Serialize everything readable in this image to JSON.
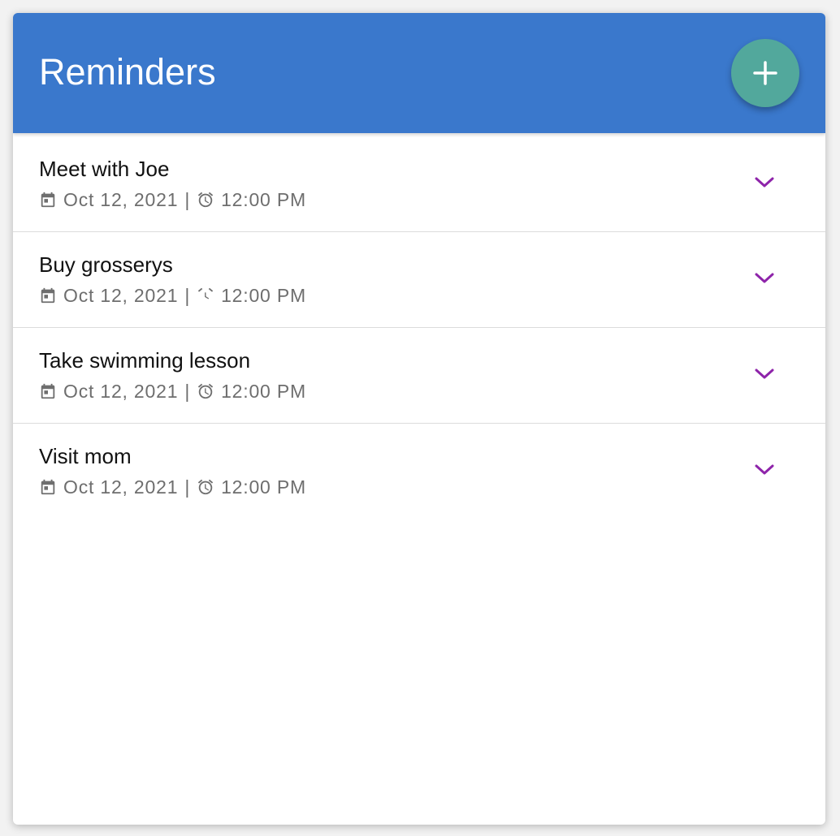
{
  "header": {
    "title": "Reminders",
    "add_icon": "plus-icon",
    "background_color": "#3a78cc",
    "fab_color": "#52a89c"
  },
  "reminders": [
    {
      "title": "Meet with Joe",
      "date": "Oct 12, 2021",
      "separator": "|",
      "time": "12:00 PM"
    },
    {
      "title": "Buy grosserys",
      "date": "Oct 12, 2021",
      "separator": "|",
      "time": "12:00 PM"
    },
    {
      "title": "Take swimming lesson",
      "date": "Oct 12, 2021",
      "separator": "|",
      "time": "12:00 PM"
    },
    {
      "title": "Visit mom",
      "date": "Oct 12, 2021",
      "separator": "|",
      "time": "12:00 PM"
    }
  ],
  "icons": {
    "date": "calendar-icon",
    "time": "alarm-clock-icon",
    "expand": "chevron-down-icon"
  },
  "colors": {
    "chevron": "#8e24aa",
    "meta_text": "#6e6e6e"
  }
}
